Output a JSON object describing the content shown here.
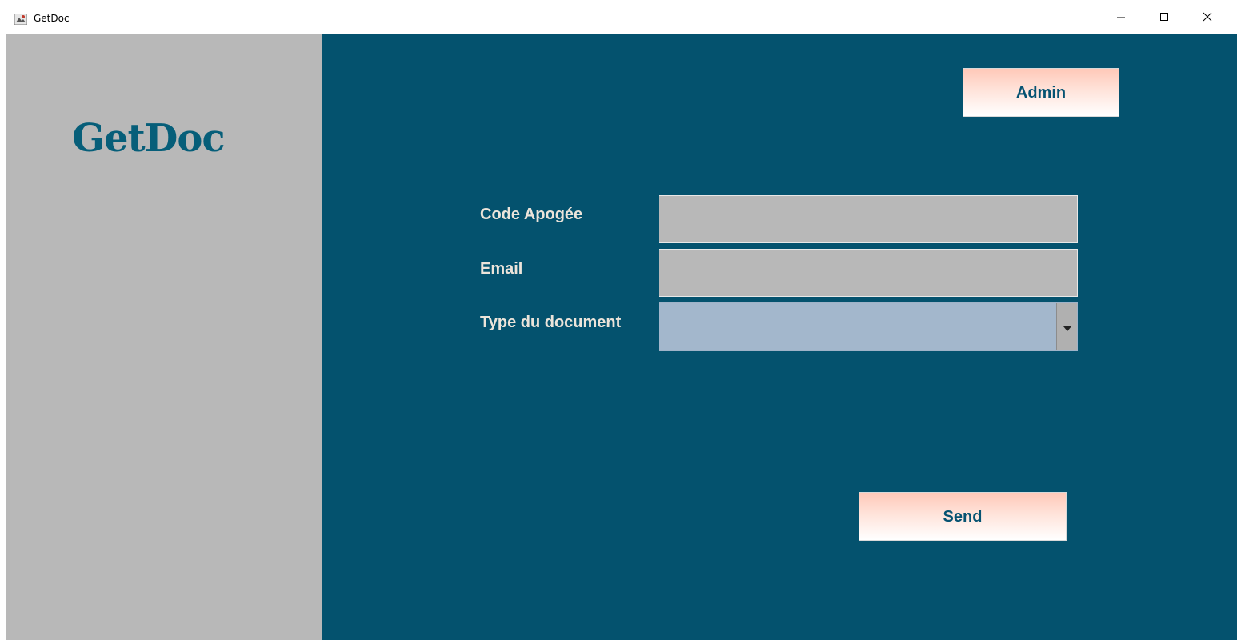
{
  "window": {
    "title": "GetDoc",
    "controls": {
      "minimize_icon": "minimize-icon",
      "maximize_icon": "maximize-icon",
      "close_icon": "close-icon"
    }
  },
  "sidebar": {
    "logo_text": "GetDoc",
    "background": "#b8b8b8",
    "logo_color": "#065e79"
  },
  "main": {
    "background": "#04526e",
    "admin_button_label": "Admin",
    "form": {
      "code_label": "Code Apogée",
      "code_value": "",
      "email_label": "Email",
      "email_value": "",
      "type_label": "Type du document",
      "type_selected": ""
    },
    "send_button_label": "Send"
  }
}
